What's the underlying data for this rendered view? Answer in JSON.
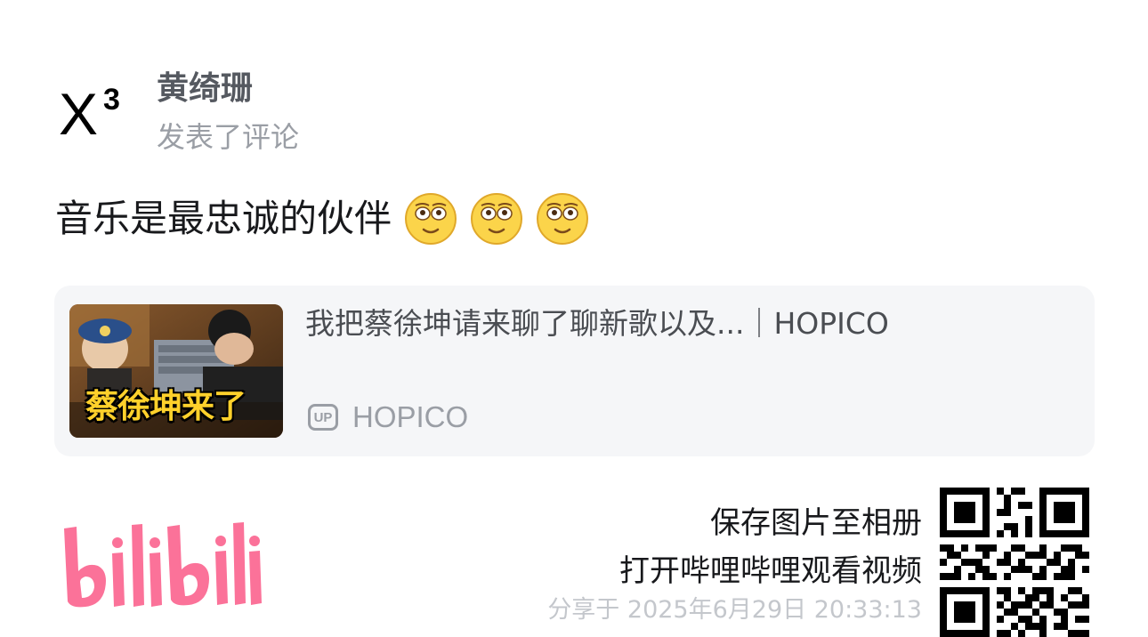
{
  "comment": {
    "avatar_letter": "X",
    "avatar_superscript": "3",
    "username": "黄绮珊",
    "action": "发表了评论",
    "text": "音乐是最忠诚的伙伴",
    "emojis": [
      "face-icon",
      "face-icon",
      "face-icon"
    ]
  },
  "video_card": {
    "thumbnail_caption": "蔡徐坤来了",
    "title": "我把蔡徐坤请来聊了聊新歌以及...｜HOPICO",
    "up_badge": "UP",
    "author": "HOPICO"
  },
  "footer": {
    "logo": "bilibili",
    "save_text": "保存图片至相册",
    "open_text": "打开哔哩哔哩观看视频",
    "share_time": "分享于 2025年6月29日 20:33:13"
  },
  "colors": {
    "brand_pink": "#fb7299",
    "card_bg": "#f5f6f8",
    "muted_text": "#9a9ea5"
  }
}
